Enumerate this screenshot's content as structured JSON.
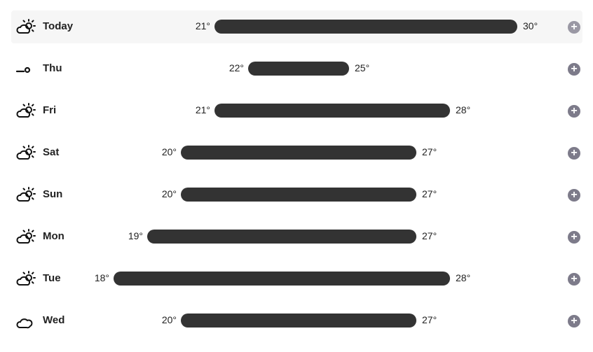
{
  "days": [
    {
      "label": "Today",
      "icon": "partly-cloudy-icon",
      "min": "21°",
      "max": "30°",
      "min_v": 21,
      "max_v": 30,
      "highlight": true
    },
    {
      "label": "Thu",
      "icon": "wind-icon",
      "min": "22°",
      "max": "25°",
      "min_v": 22,
      "max_v": 25
    },
    {
      "label": "Fri",
      "icon": "partly-cloudy-icon",
      "min": "21°",
      "max": "28°",
      "min_v": 21,
      "max_v": 28
    },
    {
      "label": "Sat",
      "icon": "partly-cloudy-icon",
      "min": "20°",
      "max": "27°",
      "min_v": 20,
      "max_v": 27
    },
    {
      "label": "Sun",
      "icon": "partly-cloudy-icon",
      "min": "20°",
      "max": "27°",
      "min_v": 20,
      "max_v": 27
    },
    {
      "label": "Mon",
      "icon": "partly-cloudy-icon",
      "min": "19°",
      "max": "27°",
      "min_v": 19,
      "max_v": 27
    },
    {
      "label": "Tue",
      "icon": "partly-cloudy-icon",
      "min": "18°",
      "max": "28°",
      "min_v": 18,
      "max_v": 28
    },
    {
      "label": "Wed",
      "icon": "cloudy-icon",
      "min": "20°",
      "max": "27°",
      "min_v": 20,
      "max_v": 27
    }
  ],
  "expand_glyph": "+"
}
